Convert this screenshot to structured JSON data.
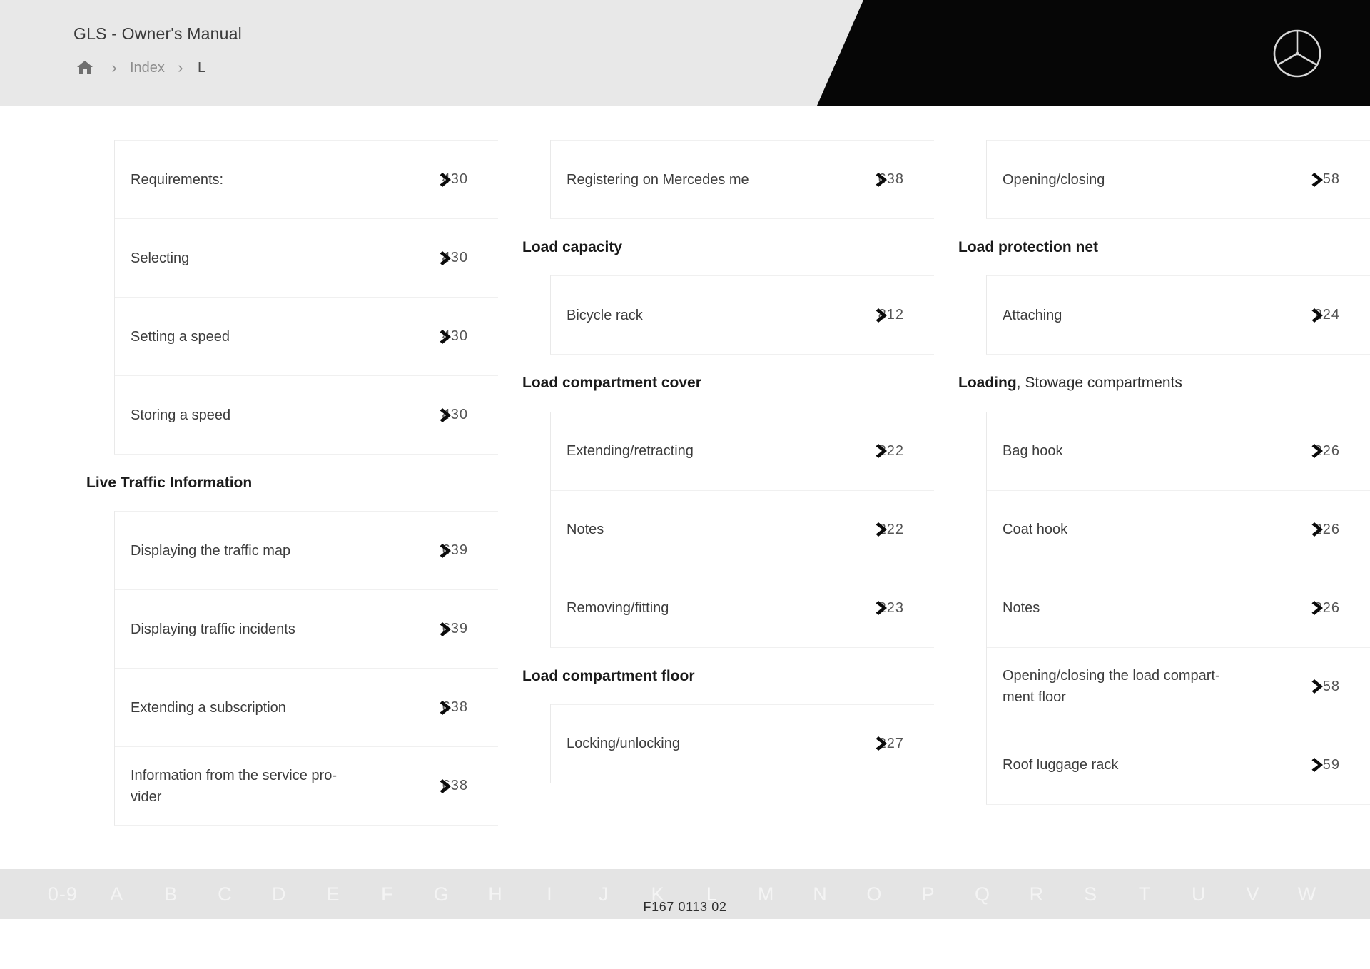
{
  "header": {
    "title": "GLS - Owner's Manual",
    "breadcrumb": {
      "home_icon": "home-icon",
      "separator": "›",
      "index_label": "Index",
      "current_label": "L"
    },
    "logo": "mercedes-benz-star-logo"
  },
  "columns": [
    {
      "blocks": [
        {
          "type": "rows",
          "rows": [
            {
              "label": "Requirements:",
              "page": "430",
              "icon": "page-arrow-icon"
            },
            {
              "label": "Selecting",
              "page": "430",
              "icon": "page-arrow-icon"
            },
            {
              "label": "Setting a speed",
              "page": "430",
              "icon": "page-arrow-icon"
            },
            {
              "label": "Storing a speed",
              "page": "430",
              "icon": "page-arrow-icon"
            }
          ]
        },
        {
          "type": "heading",
          "bold": "Live Traffic Information",
          "light": ""
        },
        {
          "type": "rows",
          "rows": [
            {
              "label": "Displaying the traffic map",
              "page": "639",
              "icon": "page-arrow-icon"
            },
            {
              "label": "Displaying traffic incidents",
              "page": "639",
              "icon": "page-arrow-icon"
            },
            {
              "label": "Extending a subscription",
              "page": "638",
              "icon": "page-arrow-icon"
            },
            {
              "label": "Information from the service pro-\nvider",
              "page": "638",
              "icon": "page-arrow-icon"
            }
          ]
        }
      ]
    },
    {
      "blocks": [
        {
          "type": "rows",
          "rows": [
            {
              "label": "Registering on Mercedes me",
              "page": "638",
              "icon": "page-arrow-icon"
            }
          ]
        },
        {
          "type": "heading",
          "bold": "Load capacity",
          "light": ""
        },
        {
          "type": "rows",
          "rows": [
            {
              "label": "Bicycle rack",
              "page": "812",
              "icon": "page-arrow-icon"
            }
          ]
        },
        {
          "type": "heading",
          "bold": "Load compartment cover",
          "light": ""
        },
        {
          "type": "rows",
          "rows": [
            {
              "label": "Extending/retracting",
              "page": "222",
              "icon": "page-arrow-icon"
            },
            {
              "label": "Notes",
              "page": "222",
              "icon": "page-arrow-icon"
            },
            {
              "label": "Removing/fitting",
              "page": "223",
              "icon": "page-arrow-icon"
            }
          ]
        },
        {
          "type": "heading",
          "bold": "Load compartment floor",
          "light": ""
        },
        {
          "type": "rows",
          "rows": [
            {
              "label": "Locking/unlocking",
              "page": "227",
              "icon": "page-arrow-icon"
            }
          ]
        }
      ]
    },
    {
      "blocks": [
        {
          "type": "rows",
          "rows": [
            {
              "label": "Opening/closing",
              "page": "58",
              "icon": "page-arrow-icon"
            }
          ]
        },
        {
          "type": "heading",
          "bold": "Load protection net",
          "light": ""
        },
        {
          "type": "rows",
          "rows": [
            {
              "label": "Attaching",
              "page": "224",
              "icon": "page-arrow-icon"
            }
          ]
        },
        {
          "type": "heading",
          "bold": "Loading",
          "light": ", Stowage compartments"
        },
        {
          "type": "rows",
          "rows": [
            {
              "label": "Bag hook",
              "page": "226",
              "icon": "page-arrow-icon"
            },
            {
              "label": "Coat hook",
              "page": "226",
              "icon": "page-arrow-icon"
            },
            {
              "label": "Notes",
              "page": "226",
              "icon": "page-arrow-icon"
            },
            {
              "label": "Opening/closing the load compart-\nment floor",
              "page": "58",
              "icon": "page-arrow-icon"
            },
            {
              "label": "Roof luggage rack",
              "page": "59",
              "icon": "page-arrow-icon"
            }
          ]
        }
      ]
    }
  ],
  "alphabet_bar": {
    "items": [
      "0-9",
      "A",
      "B",
      "C",
      "D",
      "E",
      "F",
      "G",
      "H",
      "I",
      "J",
      "K",
      "L",
      "M",
      "N",
      "O",
      "P",
      "Q",
      "R",
      "S",
      "T",
      "U",
      "V",
      "W"
    ],
    "active": "L"
  },
  "document_code": "F167 0113 02",
  "colors": {
    "header_bg": "#e8e8e8",
    "header_black": "#060606",
    "alpha_bar_bg": "#e4e4e4",
    "alpha_letter": "#f4f4f4",
    "text_primary": "#1a1a1a",
    "text_row": "#3c3c3c",
    "text_muted": "#8d8d8d",
    "divider": "#f0f0f0"
  }
}
